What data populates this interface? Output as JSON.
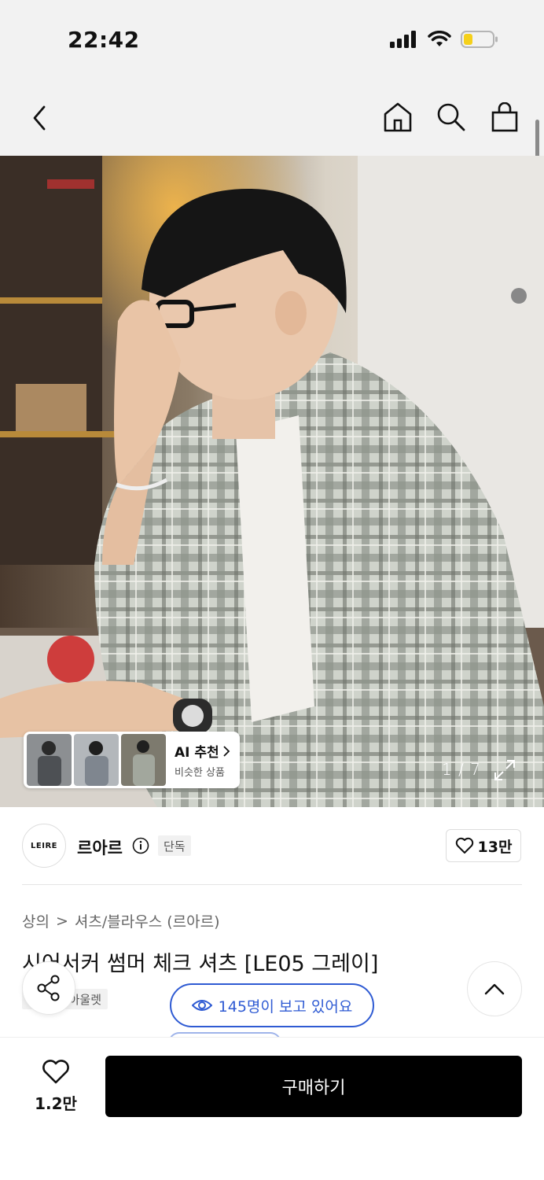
{
  "status_bar": {
    "time": "22:42",
    "battery_color": "#f5d01a"
  },
  "nav": {
    "icons": [
      "chevron-left-icon",
      "home-icon",
      "search-icon",
      "bag-icon"
    ]
  },
  "gallery": {
    "page_counter": "1 / 7",
    "ai_recommend": {
      "title": "AI 추천",
      "subtitle": "비슷한 상품"
    }
  },
  "brand": {
    "logo_text": "LEIRE",
    "name": "르아르",
    "tag": "단독",
    "likes": "13만"
  },
  "breadcrumb": {
    "category": "상의",
    "separator": ">",
    "subcategory": "셔츠/블라우스 (르아르)"
  },
  "product": {
    "title": "시어서커 썸머 체크 셔츠 [LE05 그레이]",
    "tags": [
      "단독",
      "아울렛"
    ]
  },
  "floating": {
    "viewers_text": "145명이 보고 있어요",
    "accent": "#2f5bd3"
  },
  "bottom_bar": {
    "wish_count": "1.2만",
    "buy_label": "구매하기"
  }
}
